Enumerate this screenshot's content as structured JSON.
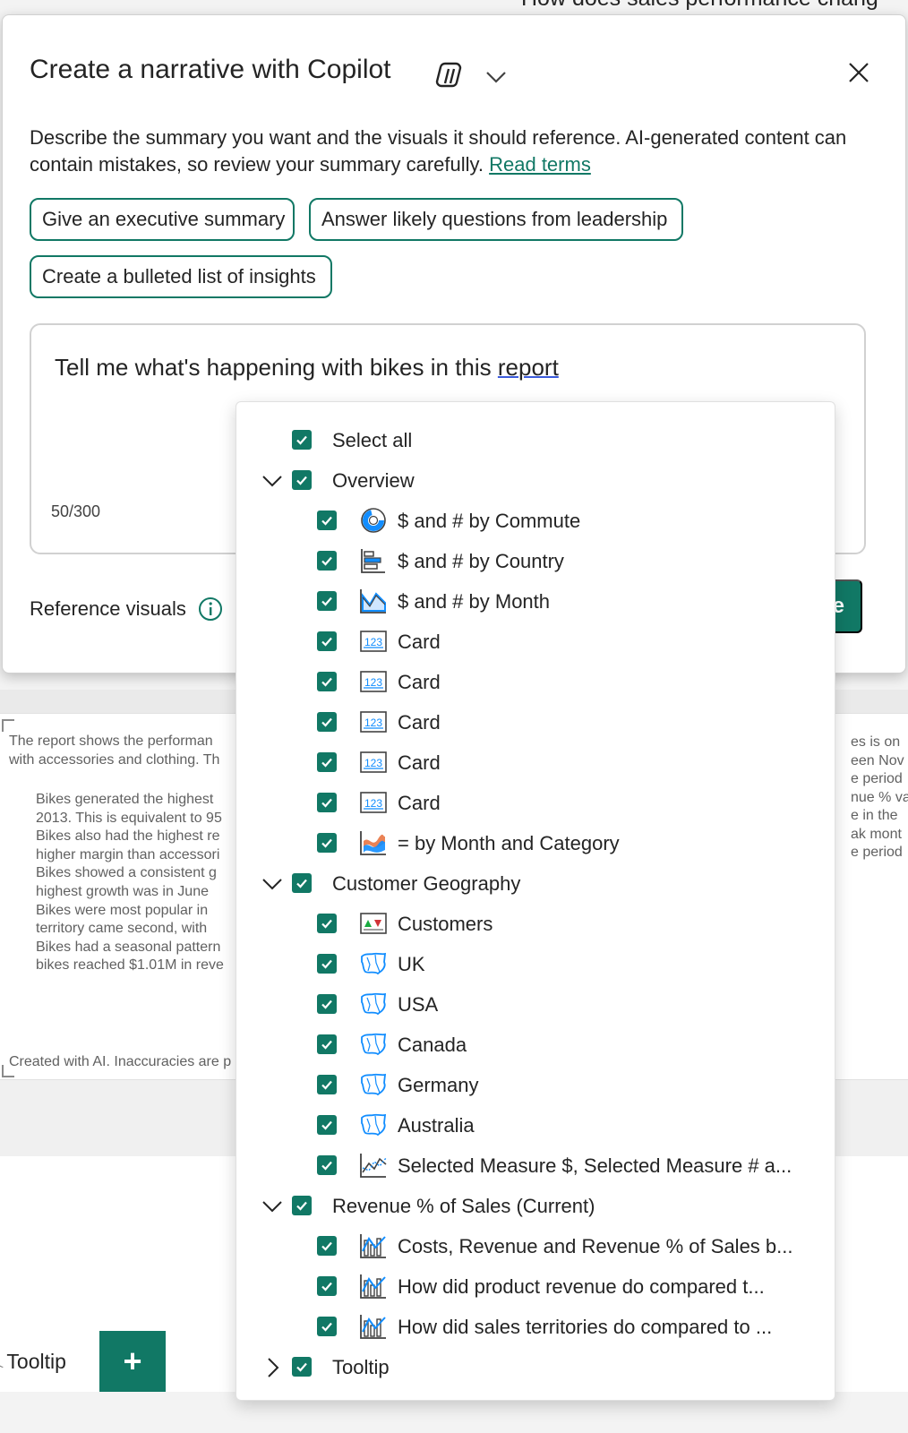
{
  "background": {
    "top_cut_title": "How does sales performance chang",
    "summary": {
      "intro_lines": [
        "The report shows the performan",
        "with accessories and clothing. Th"
      ],
      "bullets": [
        [
          "Bikes generated the highest",
          "2013. This is equivalent to 95"
        ],
        [
          "Bikes also had the highest re",
          "higher margin than accessori"
        ],
        [
          "Bikes showed a consistent g",
          "highest growth was in June"
        ],
        [
          "Bikes were most popular in",
          "territory came second, with"
        ],
        [
          "Bikes had a seasonal pattern",
          "bikes reached $1.01M in reve"
        ]
      ],
      "footer": "Created with AI. Inaccuracies are p"
    },
    "right_fragments": [
      "es is on",
      "",
      "een Nov",
      "",
      "e period",
      "",
      "nue % va",
      "",
      "e in the",
      "",
      "ak mont",
      "e period"
    ],
    "tabs": {
      "tooltip_label": "Tooltip",
      "add_label": "+"
    }
  },
  "dialog": {
    "title": "Create a narrative with Copilot",
    "description": "Describe the summary you want and the visuals it should reference. AI-generated content can contain mistakes, so review your summary carefully.",
    "terms_link": "Read terms",
    "suggestions": [
      "Give an executive summary",
      "Answer likely questions from leadership",
      "Create a bulleted list of insights"
    ],
    "prompt_text_main": "Tell me what's happening with bikes in this ",
    "prompt_text_last": "report",
    "char_counter": "50/300",
    "reference_label": "Reference visuals",
    "create_button_partial": "e"
  },
  "colors": {
    "accent": "#117865",
    "chart_blue": "#118dff",
    "chart_orange": "#e66c37"
  },
  "dropdown": {
    "select_all": "Select all",
    "groups": [
      {
        "name": "Overview",
        "expanded": true,
        "items": [
          {
            "label": "$ and # by Commute",
            "icon": "donut-chart-icon"
          },
          {
            "label": "$ and # by Country",
            "icon": "bar-chart-icon"
          },
          {
            "label": "$ and # by Month",
            "icon": "area-chart-icon"
          },
          {
            "label": "Card",
            "icon": "card-icon"
          },
          {
            "label": "Card",
            "icon": "card-icon"
          },
          {
            "label": "Card",
            "icon": "card-icon"
          },
          {
            "label": "Card",
            "icon": "card-icon"
          },
          {
            "label": "Card",
            "icon": "card-icon"
          },
          {
            "label": "= by Month and Category",
            "icon": "ribbon-chart-icon"
          }
        ]
      },
      {
        "name": "Customer Geography",
        "expanded": true,
        "items": [
          {
            "label": "Customers",
            "icon": "kpi-icon"
          },
          {
            "label": "UK",
            "icon": "map-icon"
          },
          {
            "label": "USA",
            "icon": "map-icon"
          },
          {
            "label": "Canada",
            "icon": "map-icon"
          },
          {
            "label": "Germany",
            "icon": "map-icon"
          },
          {
            "label": "Australia",
            "icon": "map-icon"
          },
          {
            "label": "Selected Measure $, Selected Measure # a...",
            "icon": "line-chart-icon"
          }
        ]
      },
      {
        "name": "Revenue % of Sales (Current)",
        "expanded": true,
        "items": [
          {
            "label": "Costs, Revenue and Revenue % of Sales b...",
            "icon": "combo-chart-icon"
          },
          {
            "label": "How did product revenue do compared t...",
            "icon": "combo-chart-icon"
          },
          {
            "label": "How did sales territories do compared to ...",
            "icon": "combo-chart-icon"
          }
        ]
      },
      {
        "name": "Tooltip",
        "expanded": false,
        "items": []
      }
    ]
  }
}
